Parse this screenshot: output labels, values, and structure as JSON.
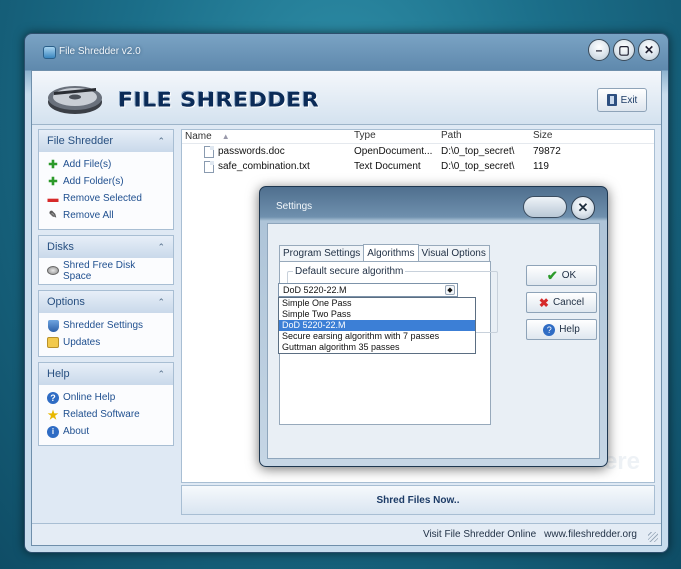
{
  "window": {
    "title": "File Shredder v2.0",
    "controls": {
      "minimize": "–",
      "maximize": "▢",
      "close": "✕"
    }
  },
  "header": {
    "logo_text": "FILE SHREDDER",
    "exit_label": "Exit"
  },
  "sidebar": {
    "file_shredder": {
      "title": "File Shredder",
      "items": [
        {
          "label": "Add File(s)",
          "icon": "add-icon"
        },
        {
          "label": "Add Folder(s)",
          "icon": "add-icon"
        },
        {
          "label": "Remove Selected",
          "icon": "remove-icon"
        },
        {
          "label": "Remove All",
          "icon": "eraser-icon"
        }
      ]
    },
    "disks": {
      "title": "Disks",
      "items": [
        {
          "label": "Shred Free Disk Space",
          "icon": "disk-icon"
        }
      ]
    },
    "options": {
      "title": "Options",
      "items": [
        {
          "label": "Shredder Settings",
          "icon": "settings-icon"
        },
        {
          "label": "Updates",
          "icon": "updates-icon"
        }
      ]
    },
    "help": {
      "title": "Help",
      "items": [
        {
          "label": "Online Help",
          "icon": "help-icon"
        },
        {
          "label": "Related Software",
          "icon": "star-icon"
        },
        {
          "label": "About",
          "icon": "about-icon"
        }
      ]
    },
    "collapse_glyph": "⌃"
  },
  "filelist": {
    "columns": {
      "name": "Name",
      "type": "Type",
      "path": "Path",
      "size": "Size"
    },
    "rows": [
      {
        "name": "passwords.doc",
        "type": "OpenDocument...",
        "path": "D:\\0_top_secret\\",
        "size": "79872"
      },
      {
        "name": "safe_combination.txt",
        "type": "Text Document",
        "path": "D:\\0_top_secret\\",
        "size": "119"
      }
    ],
    "watermark": "ere"
  },
  "shred_button": "Shred Files Now..",
  "statusbar": {
    "link_text": "Visit File Shredder Online",
    "url": "www.fileshredder.org"
  },
  "settings_dialog": {
    "title": "Settings",
    "tabs": [
      "Program Settings",
      "Algorithms",
      "Visual Options"
    ],
    "active_tab": "Algorithms",
    "group_label": "Default secure algorithm",
    "selected_value": "DoD 5220-22.M",
    "options": [
      "Simple One Pass",
      "Simple Two Pass",
      "DoD 5220-22.M",
      "Secure earsing algorithm with 7 passes",
      "Guttman algorithm 35 passes"
    ],
    "ok_label": "OK",
    "cancel_label": "Cancel",
    "help_label": "Help"
  },
  "colors": {
    "desktop": "#1b6e89",
    "accent": "#3c7fd6",
    "sidebar_link": "#1f4f8f"
  }
}
